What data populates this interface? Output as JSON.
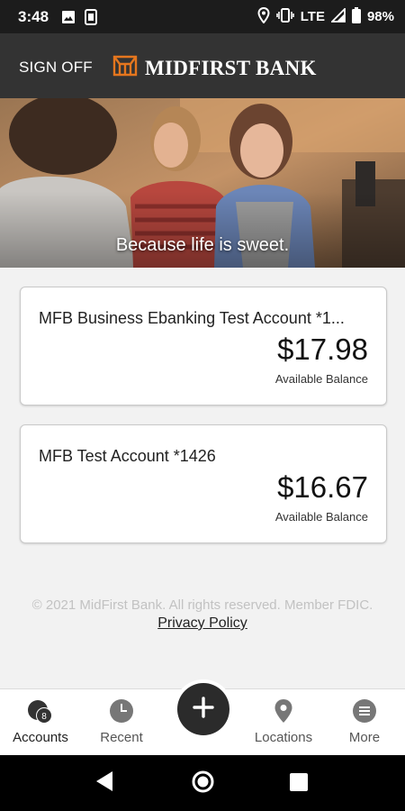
{
  "status_bar": {
    "time": "3:48",
    "network": "LTE",
    "battery": "98%",
    "icons": [
      "image-icon",
      "sim-icon",
      "location-icon",
      "vibrate-icon",
      "signal-icon",
      "battery-icon"
    ]
  },
  "header": {
    "sign_off": "SIGN OFF",
    "brand_name": "MIDFIRST BANK",
    "brand_color": "#e5761e"
  },
  "hero": {
    "caption": "Because life is sweet."
  },
  "accounts": [
    {
      "name": "MFB Business Ebanking Test Account *1...",
      "amount": "$17.98",
      "label": "Available Balance"
    },
    {
      "name": "MFB Test Account *1426",
      "amount": "$16.67",
      "label": "Available Balance"
    }
  ],
  "footer": {
    "copyright": "© 2021 MidFirst Bank. All rights reserved. Member FDIC.",
    "privacy": "Privacy Policy"
  },
  "bottom_nav": {
    "items": [
      {
        "label": "Accounts",
        "icon": "accounts-icon",
        "badge": "8"
      },
      {
        "label": "Recent",
        "icon": "clock-icon"
      },
      {
        "label": "Locations",
        "icon": "location-pin-icon"
      },
      {
        "label": "More",
        "icon": "menu-icon"
      }
    ],
    "fab_icon": "plus-icon"
  }
}
